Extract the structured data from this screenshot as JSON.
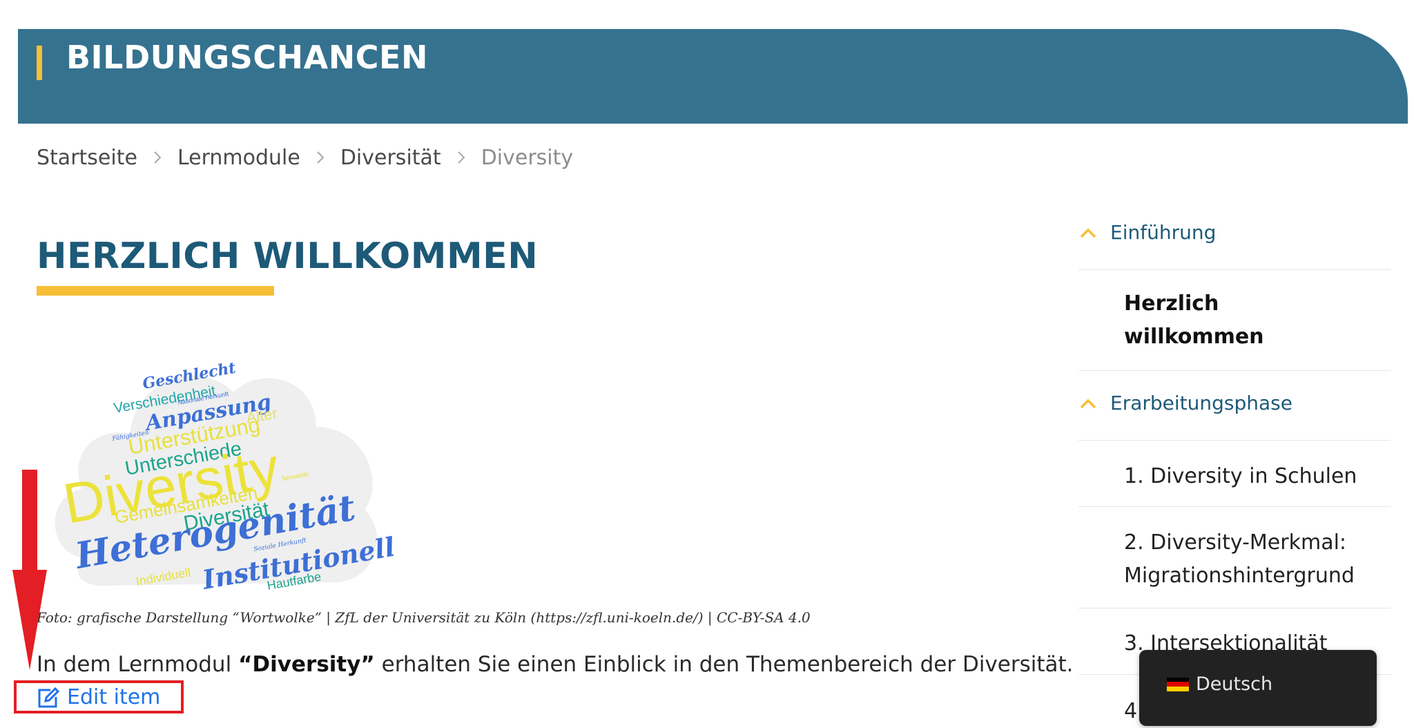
{
  "header": {
    "title": "BILDUNGSCHANCEN",
    "accent_color": "#f7bf36",
    "background_color": "#35728f"
  },
  "breadcrumb": [
    {
      "label": "Startseite"
    },
    {
      "label": "Lernmodule"
    },
    {
      "label": "Diversität"
    },
    {
      "label": "Diversity"
    }
  ],
  "main": {
    "title": "HERZLICH WILLKOMMEN",
    "image": {
      "words": [
        "Geschlecht",
        "Verschiedenheit",
        "Nationale Herkunft",
        "Anpassung",
        "Alter",
        "Fähigkeiten",
        "Unterstützung",
        "Unterschiede",
        "Diversity",
        "Sexualität",
        "Gemeinsamkeiten",
        "Diversität",
        "Heterogenität",
        "Soziale Herkunft",
        "Institutionell",
        "Individuell",
        "Hautfarbe"
      ]
    },
    "caption": "Foto: grafische Darstellung “Wortwolke” | ZfL der Universität zu Köln (https://zfl.uni-koeln.de/) | CC-BY-SA 4.0",
    "intro_before": "In dem Lernmodul ",
    "intro_bold": "“Diversity”",
    "intro_after": " erhalten Sie einen Einblick in den Themenbereich der Diversität.",
    "edit_label": "Edit item"
  },
  "sidebar": {
    "sections": [
      {
        "label": "Einführung",
        "icon": "chevron-up-icon"
      },
      {
        "label": "Erarbeitungsphase",
        "icon": "chevron-up-icon"
      }
    ],
    "items": [
      {
        "line1": "Herzlich",
        "line2": "willkommen",
        "active": true
      },
      {
        "line1": "1. Diversity in Schulen",
        "line2": ""
      },
      {
        "line1": "2. Diversity-Merkmal:",
        "line2": "Migrationshintergrund"
      },
      {
        "line1": "3. Intersektionalität",
        "line2": ""
      },
      {
        "line1": "4",
        "line2": ""
      }
    ]
  },
  "language_popup": {
    "label": "Deutsch",
    "flag": "flag-de-icon"
  },
  "annotation": {
    "arrow_color": "#e31e24",
    "box_color": "#e31e24"
  }
}
